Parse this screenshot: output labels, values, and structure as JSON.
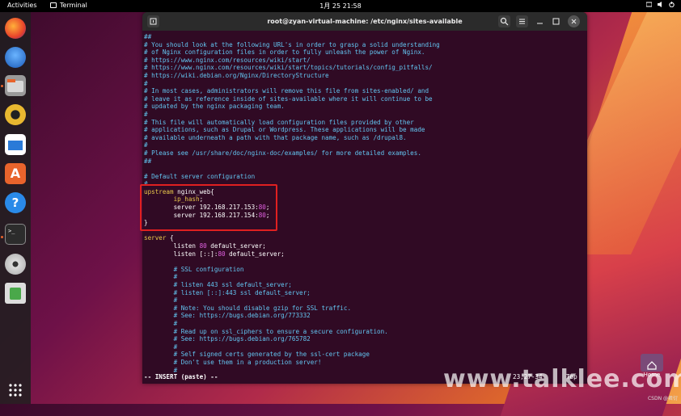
{
  "topbar": {
    "activities": "Activities",
    "app_name": "Terminal",
    "clock": "1月 25  21:58"
  },
  "dock": {
    "items": [
      "firefox-icon",
      "thunderbird-icon",
      "files-icon",
      "rhythmbox-icon",
      "writer-icon",
      "software-icon",
      "help-icon",
      "terminal-icon",
      "disc-icon",
      "trash-icon",
      "apps-grid-icon"
    ]
  },
  "terminal": {
    "title": "root@zyan-virtual-machine: /etc/nginx/sites-available",
    "lines": [
      [
        [
          "c",
          "##"
        ]
      ],
      [
        [
          "c",
          "# You should look at the following URL's in order to grasp a solid understanding"
        ]
      ],
      [
        [
          "c",
          "# of Nginx configuration files in order to fully unleash the power of Nginx."
        ]
      ],
      [
        [
          "c",
          "# https://www.nginx.com/resources/wiki/start/"
        ]
      ],
      [
        [
          "c",
          "# https://www.nginx.com/resources/wiki/start/topics/tutorials/config_pitfalls/"
        ]
      ],
      [
        [
          "c",
          "# https://wiki.debian.org/Nginx/DirectoryStructure"
        ]
      ],
      [
        [
          "c",
          "#"
        ]
      ],
      [
        [
          "c",
          "# In most cases, administrators will remove this file from sites-enabled/ and"
        ]
      ],
      [
        [
          "c",
          "# leave it as reference inside of sites-available where it will continue to be"
        ]
      ],
      [
        [
          "c",
          "# updated by the nginx packaging team."
        ]
      ],
      [
        [
          "c",
          "#"
        ]
      ],
      [
        [
          "c",
          "# This file will automatically load configuration files provided by other"
        ]
      ],
      [
        [
          "c",
          "# applications, such as Drupal or Wordpress. These applications will be made"
        ]
      ],
      [
        [
          "c",
          "# available underneath a path with that package name, such as /drupal8."
        ]
      ],
      [
        [
          "c",
          "#"
        ]
      ],
      [
        [
          "c",
          "# Please see /usr/share/doc/nginx-doc/examples/ for more detailed examples."
        ]
      ],
      [
        [
          "c",
          "##"
        ]
      ],
      [
        [
          "t",
          ""
        ]
      ],
      [
        [
          "c",
          "# Default server configuration"
        ]
      ],
      [
        [
          "c",
          "#"
        ]
      ],
      [
        [
          "k",
          "upstream"
        ],
        [
          "t",
          " nginx_web{"
        ]
      ],
      [
        [
          "t",
          "        "
        ],
        [
          "y",
          "ip_hash"
        ],
        [
          "t",
          ";"
        ]
      ],
      [
        [
          "t",
          "        server 192.168.217.153:"
        ],
        [
          "n",
          "80"
        ],
        [
          "t",
          ";"
        ]
      ],
      [
        [
          "t",
          "        server 192.168.217.154:"
        ],
        [
          "n",
          "80"
        ],
        [
          "t",
          ";"
        ]
      ],
      [
        [
          "t",
          "}"
        ]
      ],
      [
        [
          "t",
          ""
        ]
      ],
      [
        [
          "y",
          "server"
        ],
        [
          "t",
          " {"
        ]
      ],
      [
        [
          "t",
          "        listen "
        ],
        [
          "n",
          "80"
        ],
        [
          "t",
          " default_server;"
        ]
      ],
      [
        [
          "t",
          "        listen [::]:"
        ],
        [
          "n",
          "80"
        ],
        [
          "t",
          " default_server;"
        ]
      ],
      [
        [
          "t",
          ""
        ]
      ],
      [
        [
          "t",
          "        "
        ],
        [
          "c",
          "# SSL configuration"
        ]
      ],
      [
        [
          "t",
          "        "
        ],
        [
          "c",
          "#"
        ]
      ],
      [
        [
          "t",
          "        "
        ],
        [
          "c",
          "# listen 443 ssl default_server;"
        ]
      ],
      [
        [
          "t",
          "        "
        ],
        [
          "c",
          "# listen [::]:443 ssl default_server;"
        ]
      ],
      [
        [
          "t",
          "        "
        ],
        [
          "c",
          "#"
        ]
      ],
      [
        [
          "t",
          "        "
        ],
        [
          "c",
          "# Note: You should disable gzip for SSL traffic."
        ]
      ],
      [
        [
          "t",
          "        "
        ],
        [
          "c",
          "# See: https://bugs.debian.org/773332"
        ]
      ],
      [
        [
          "t",
          "        "
        ],
        [
          "c",
          "#"
        ]
      ],
      [
        [
          "t",
          "        "
        ],
        [
          "c",
          "# Read up on ssl_ciphers to ensure a secure configuration."
        ]
      ],
      [
        [
          "t",
          "        "
        ],
        [
          "c",
          "# See: https://bugs.debian.org/765782"
        ]
      ],
      [
        [
          "t",
          "        "
        ],
        [
          "c",
          "#"
        ]
      ],
      [
        [
          "t",
          "        "
        ],
        [
          "c",
          "# Self signed certs generated by the ssl-cert package"
        ]
      ],
      [
        [
          "t",
          "        "
        ],
        [
          "c",
          "# Don't use them in a production server!"
        ]
      ],
      [
        [
          "t",
          "        "
        ],
        [
          "c",
          "#"
        ]
      ]
    ],
    "status_mode": "-- INSERT (paste) --",
    "status_pos": "23,27-34",
    "status_pct": "Top"
  },
  "desktop": {
    "home_label": "Home",
    "watermark": "www.talklee.com",
    "csdn": "CSDN @君衍"
  },
  "colors": {
    "terminal_bg": "#300a24",
    "comment": "#62c4f0",
    "keyword": "#e8c84c",
    "number": "#e060e0",
    "highlight_box": "#e02020"
  }
}
